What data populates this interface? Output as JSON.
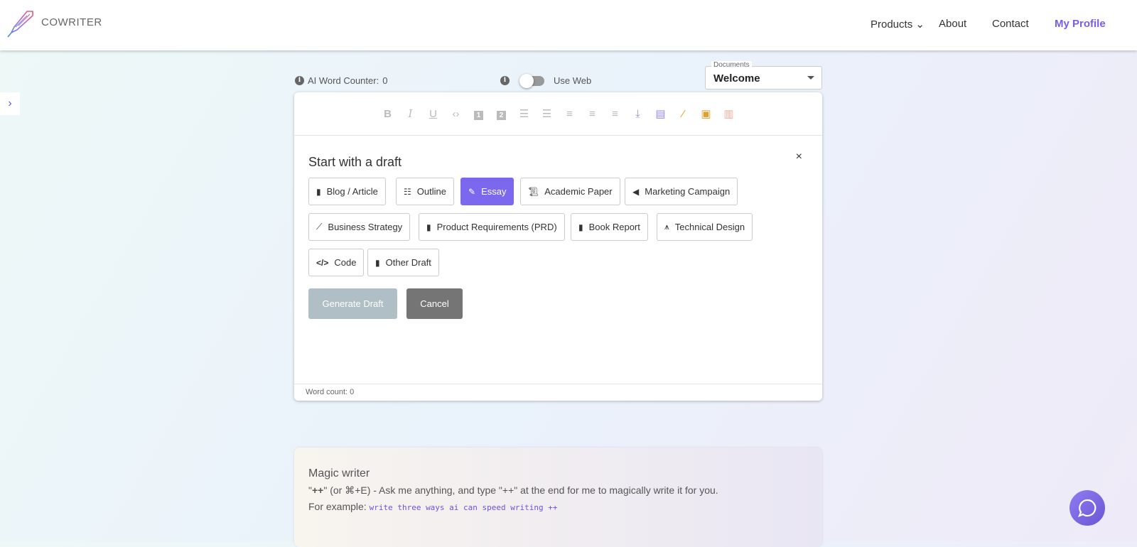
{
  "header": {
    "brand": "COWRITER",
    "nav": [
      "Products",
      "About",
      "Contact",
      "My Profile"
    ]
  },
  "topbar": {
    "ai_word_counter_label": "AI Word Counter:",
    "ai_word_counter_value": "0",
    "use_web_label": "Use Web",
    "documents_label": "Documents",
    "documents_value": "Welcome"
  },
  "toolbar": {
    "icons": [
      "bold",
      "italic",
      "underline",
      "code",
      "heading-1",
      "heading-2",
      "ordered-list",
      "bullet-list",
      "align-left",
      "align-center",
      "align-right",
      "download",
      "add-note",
      "magic-wand",
      "add-image",
      "delete"
    ]
  },
  "draft": {
    "title": "Start with a draft",
    "close": "×",
    "options": [
      "Blog / Article",
      "Outline",
      "Essay",
      "Academic Paper",
      "Marketing Campaign",
      "Business Strategy",
      "Product Requirements (PRD)",
      "Book Report",
      "Technical Design",
      "Code",
      "Other Draft"
    ],
    "selected": "Essay",
    "generate": "Generate Draft",
    "cancel": "Cancel"
  },
  "footer": {
    "word_count": "Word count: 0"
  },
  "magic": {
    "title": "Magic writer",
    "desc_pre": "\"",
    "desc_bold": "++",
    "desc_post": "\" (or ⌘+E) - Ask me anything, and type \"++\" at the end for me to magically write it for you.",
    "example_label": "For example:",
    "example_code": "write three ways ai can speed writing ++"
  },
  "colors": {
    "accent": "#7b5ce6"
  }
}
